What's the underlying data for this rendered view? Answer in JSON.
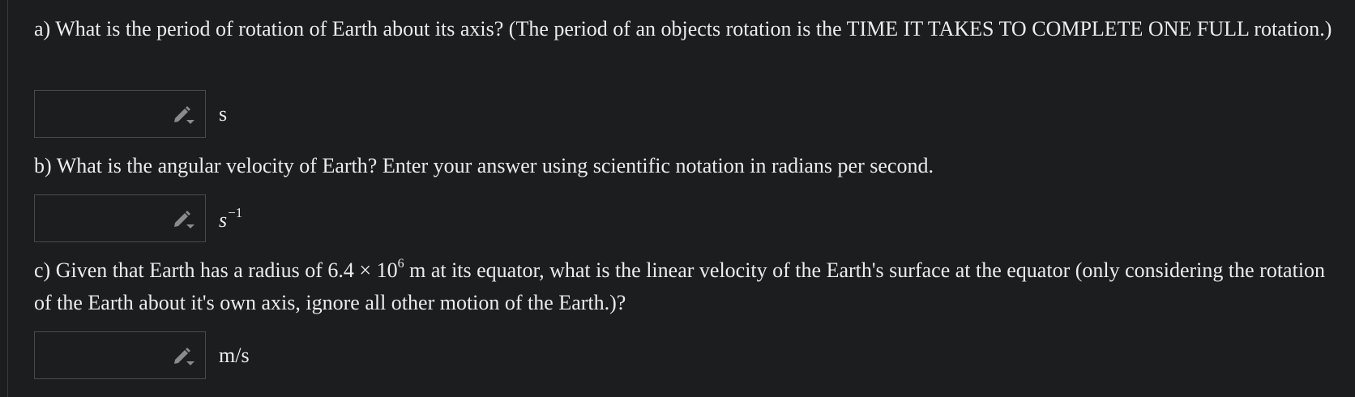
{
  "questions": {
    "a": {
      "text": "a) What is the period of rotation of Earth about its axis? (The period of an objects rotation is the TIME IT TAKES TO COMPLETE ONE FULL rotation.)",
      "unit": "s"
    },
    "b": {
      "text": "b) What is the angular velocity of Earth? Enter your answer using scientific notation in radians per second.",
      "unit_base": "s",
      "unit_exponent": "−1"
    },
    "c": {
      "text_before": "c) Given that Earth has a radius of 6.4 × 10",
      "text_exponent": "6",
      "text_after": " m at its equator, what is the linear velocity of the Earth's surface at the equator (only considering the rotation of the Earth about it's own axis, ignore all other motion of the Earth.)?",
      "unit": "m/s"
    }
  },
  "inputs": {
    "a_value": "",
    "b_value": "",
    "c_value": ""
  },
  "icons": {
    "edit": "pencil-dropdown-icon"
  },
  "colors": {
    "background": "#1c1d1f",
    "text": "#ececec",
    "input_border": "#4a4b4e",
    "icon": "#8a8b8e"
  }
}
